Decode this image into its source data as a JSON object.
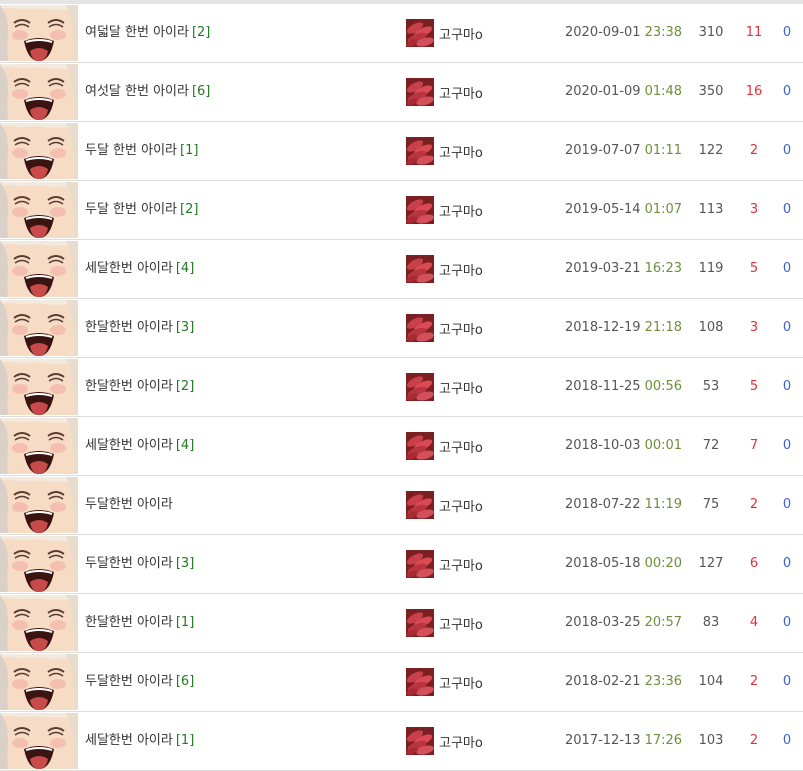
{
  "colors": {
    "title": "#333333",
    "comment_count": "#227a22",
    "time": "#6e8f3a",
    "likes": "#e0313b",
    "dislikes": "#3d5fd9",
    "row_border": "#dddddd"
  },
  "icons": {
    "thumbnail": "anime-laughing-face-thumbnail",
    "avatar": "sweet-potato-avatar-icon"
  },
  "posts": [
    {
      "title": "여덟달 한번 아이라",
      "comments": "[2]",
      "author": "고구마o",
      "date": "2020-09-01",
      "time": "23:38",
      "views": "310",
      "likes": "11",
      "dislikes": "0"
    },
    {
      "title": "여섯달 한번 아이라",
      "comments": "[6]",
      "author": "고구마o",
      "date": "2020-01-09",
      "time": "01:48",
      "views": "350",
      "likes": "16",
      "dislikes": "0"
    },
    {
      "title": "두달 한번 아이라",
      "comments": "[1]",
      "author": "고구마o",
      "date": "2019-07-07",
      "time": "01:11",
      "views": "122",
      "likes": "2",
      "dislikes": "0"
    },
    {
      "title": "두달 한번 아이라",
      "comments": "[2]",
      "author": "고구마o",
      "date": "2019-05-14",
      "time": "01:07",
      "views": "113",
      "likes": "3",
      "dislikes": "0"
    },
    {
      "title": "세달한번 아이라",
      "comments": "[4]",
      "author": "고구마o",
      "date": "2019-03-21",
      "time": "16:23",
      "views": "119",
      "likes": "5",
      "dislikes": "0"
    },
    {
      "title": "한달한번 아이라",
      "comments": "[3]",
      "author": "고구마o",
      "date": "2018-12-19",
      "time": "21:18",
      "views": "108",
      "likes": "3",
      "dislikes": "0"
    },
    {
      "title": "한달한번 아이라",
      "comments": "[2]",
      "author": "고구마o",
      "date": "2018-11-25",
      "time": "00:56",
      "views": "53",
      "likes": "5",
      "dislikes": "0"
    },
    {
      "title": "세달한번 아이라",
      "comments": "[4]",
      "author": "고구마o",
      "date": "2018-10-03",
      "time": "00:01",
      "views": "72",
      "likes": "7",
      "dislikes": "0"
    },
    {
      "title": "두달한번 아이라",
      "comments": "",
      "author": "고구마o",
      "date": "2018-07-22",
      "time": "11:19",
      "views": "75",
      "likes": "2",
      "dislikes": "0"
    },
    {
      "title": "두달한번 아이라",
      "comments": "[3]",
      "author": "고구마o",
      "date": "2018-05-18",
      "time": "00:20",
      "views": "127",
      "likes": "6",
      "dislikes": "0"
    },
    {
      "title": "한달한번 아이라",
      "comments": "[1]",
      "author": "고구마o",
      "date": "2018-03-25",
      "time": "20:57",
      "views": "83",
      "likes": "4",
      "dislikes": "0"
    },
    {
      "title": "두달한번 아이라",
      "comments": "[6]",
      "author": "고구마o",
      "date": "2018-02-21",
      "time": "23:36",
      "views": "104",
      "likes": "2",
      "dislikes": "0"
    },
    {
      "title": "세달한번 아이라",
      "comments": "[1]",
      "author": "고구마o",
      "date": "2017-12-13",
      "time": "17:26",
      "views": "103",
      "likes": "2",
      "dislikes": "0"
    }
  ]
}
